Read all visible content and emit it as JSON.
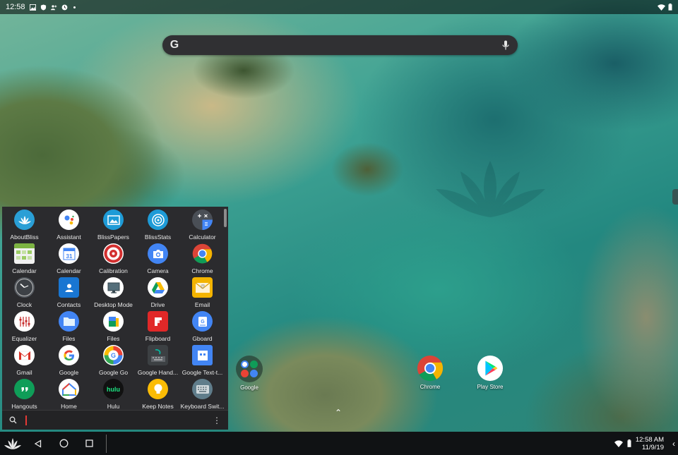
{
  "status_bar": {
    "time": "12:58",
    "icons": [
      "image-icon",
      "shield-icon",
      "account-icon",
      "alarm-icon",
      "dot-icon"
    ],
    "right_icons": [
      "wifi-icon",
      "battery-icon"
    ]
  },
  "search": {
    "logo": "G",
    "icons": [
      "google-logo",
      "mic-icon"
    ]
  },
  "desktop": {
    "icons": [
      {
        "label": "Google"
      },
      {
        "label": "Chrome"
      },
      {
        "label": "Play Store"
      }
    ]
  },
  "drawer": {
    "apps": [
      {
        "label": "AboutBliss",
        "icon": "bliss-lotus-icon"
      },
      {
        "label": "Assistant",
        "icon": "assistant-icon"
      },
      {
        "label": "BlissPapers",
        "icon": "blisspapers-icon"
      },
      {
        "label": "BlissStats",
        "icon": "blissstats-icon"
      },
      {
        "label": "Calculator",
        "icon": "calculator-icon"
      },
      {
        "label": "Calendar",
        "icon": "calendar-grid-icon"
      },
      {
        "label": "Calendar",
        "icon": "calendar-31-icon"
      },
      {
        "label": "Calibration",
        "icon": "target-icon"
      },
      {
        "label": "Camera",
        "icon": "camera-icon"
      },
      {
        "label": "Chrome",
        "icon": "chrome-icon"
      },
      {
        "label": "Clock",
        "icon": "clock-icon"
      },
      {
        "label": "Contacts",
        "icon": "contacts-icon"
      },
      {
        "label": "Desktop Mode",
        "icon": "monitor-icon"
      },
      {
        "label": "Drive",
        "icon": "drive-icon"
      },
      {
        "label": "Email",
        "icon": "email-icon"
      },
      {
        "label": "Equalizer",
        "icon": "equalizer-icon"
      },
      {
        "label": "Files",
        "icon": "folder-icon"
      },
      {
        "label": "Files",
        "icon": "files-go-icon"
      },
      {
        "label": "Flipboard",
        "icon": "flipboard-icon"
      },
      {
        "label": "Gboard",
        "icon": "gboard-icon"
      },
      {
        "label": "Gmail",
        "icon": "gmail-icon"
      },
      {
        "label": "Google",
        "icon": "google-icon"
      },
      {
        "label": "Google Go",
        "icon": "google-go-icon"
      },
      {
        "label": "Google Hand...",
        "icon": "handwriting-icon"
      },
      {
        "label": "Google Text-t...",
        "icon": "text-to-speech-icon"
      },
      {
        "label": "Hangouts",
        "icon": "hangouts-icon"
      },
      {
        "label": "Home",
        "icon": "google-home-icon"
      },
      {
        "label": "Hulu",
        "icon": "hulu-icon",
        "text": "hulu"
      },
      {
        "label": "Keep Notes",
        "icon": "keep-bulb-icon"
      },
      {
        "label": "Keyboard Swit...",
        "icon": "keyboard-icon"
      }
    ],
    "search_icon": "search-icon",
    "more_icon": "more-vert-icon"
  },
  "taskbar": {
    "clock_time": "12:58 AM",
    "clock_date": "11/9/19",
    "buttons": [
      "bliss-home-icon",
      "back-icon",
      "home-icon",
      "recents-icon"
    ],
    "tray_icons": [
      "wifi-icon",
      "battery-icon"
    ],
    "tray_chevron": "‹"
  },
  "colors": {
    "drawer_bg": "#2b2b2e",
    "taskbar_bg": "#101214",
    "search_bg": "#303033",
    "accent_cursor": "#e53935"
  }
}
